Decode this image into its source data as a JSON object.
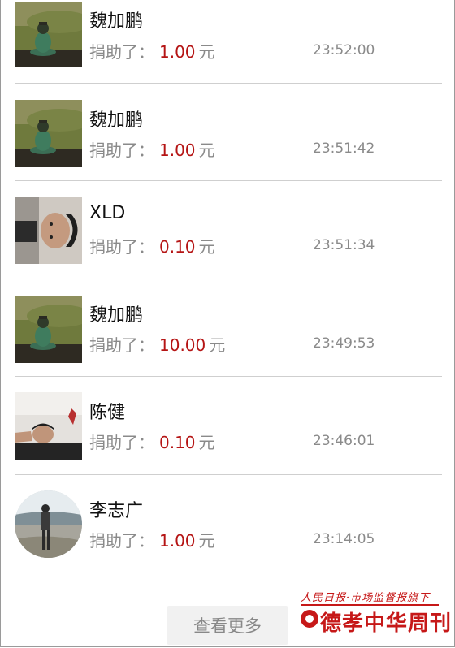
{
  "donations": [
    {
      "name": "魏加鹏",
      "label": "捐助了：",
      "amount": "1.00",
      "unit": "元",
      "time": "23:52:00",
      "avatar": "buddha-statue"
    },
    {
      "name": "魏加鹏",
      "label": "捐助了：",
      "amount": "1.00",
      "unit": "元",
      "time": "23:51:42",
      "avatar": "buddha-statue"
    },
    {
      "name": "XLD",
      "label": "捐助了：",
      "amount": "0.10",
      "unit": "元",
      "time": "23:51:34",
      "avatar": "man-portrait-rotated"
    },
    {
      "name": "魏加鹏",
      "label": "捐助了：",
      "amount": "10.00",
      "unit": "元",
      "time": "23:49:53",
      "avatar": "buddha-statue"
    },
    {
      "name": "陈健",
      "label": "捐助了：",
      "amount": "0.10",
      "unit": "元",
      "time": "23:46:01",
      "avatar": "man-lying-portrait"
    },
    {
      "name": "李志广",
      "label": "捐助了：",
      "amount": "1.00",
      "unit": "元",
      "time": "23:14:05",
      "avatar": "man-on-beach-round"
    }
  ],
  "more_button": "查看更多",
  "watermark": {
    "line1": "人民日报·市场监督报旗下",
    "line2": "德孝中华周刊"
  },
  "colors": {
    "amount": "#b51414",
    "muted_text": "#8a8a8a",
    "divider": "#cfcfcf",
    "watermark": "#c61818"
  }
}
